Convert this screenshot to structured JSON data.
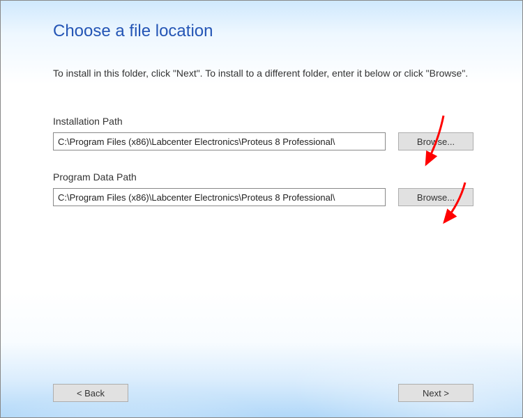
{
  "title": "Choose a file location",
  "description": "To install in this folder, click \"Next\". To install to a different folder, enter it below or click \"Browse\".",
  "fields": {
    "install": {
      "label": "Installation Path",
      "value": "C:\\Program Files (x86)\\Labcenter Electronics\\Proteus 8 Professional\\",
      "browse_label": "Browse..."
    },
    "data": {
      "label": "Program Data Path",
      "value": "C:\\Program Files (x86)\\Labcenter Electronics\\Proteus 8 Professional\\",
      "browse_label": "Browse..."
    }
  },
  "buttons": {
    "back_label": "< Back",
    "next_label": "Next >"
  },
  "annotations": {
    "arrow_color": "#ff0000"
  }
}
